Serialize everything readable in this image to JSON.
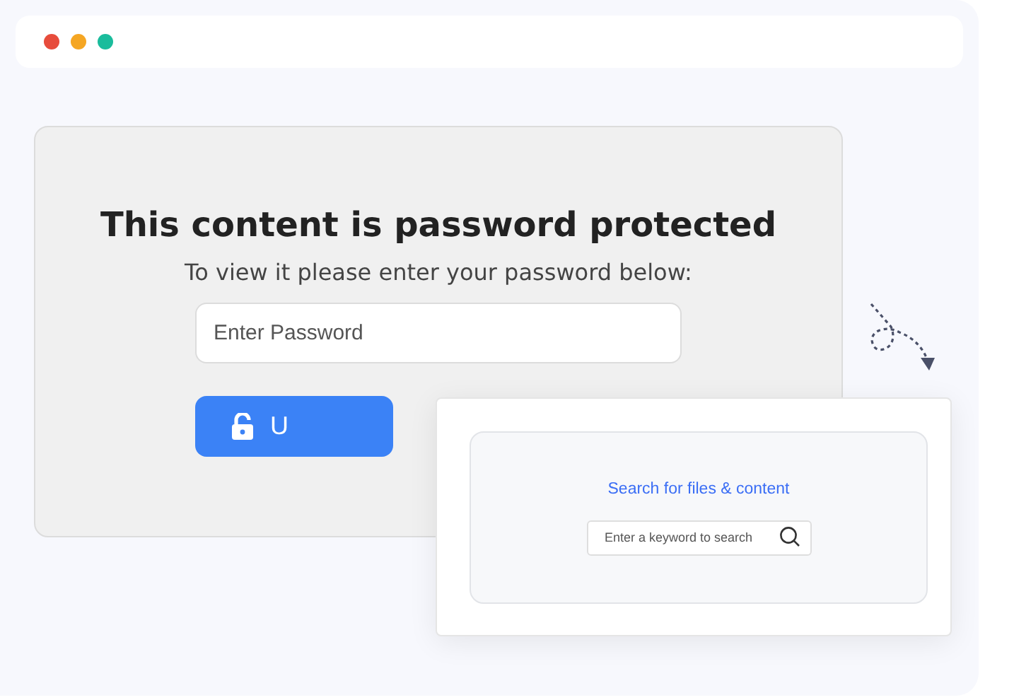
{
  "window": {
    "controls": [
      {
        "color": "#e74c3c"
      },
      {
        "color": "#f5a623"
      },
      {
        "color": "#1abc9c"
      }
    ]
  },
  "protected_page": {
    "title": "This content is password protected",
    "subtitle": "To view it please enter your password below:",
    "password_field": {
      "placeholder": "Enter Password"
    },
    "unlock_button": {
      "label": "U"
    }
  },
  "search_panel": {
    "title": "Search for files & content",
    "search_field": {
      "placeholder": "Enter a keyword to search"
    }
  }
}
